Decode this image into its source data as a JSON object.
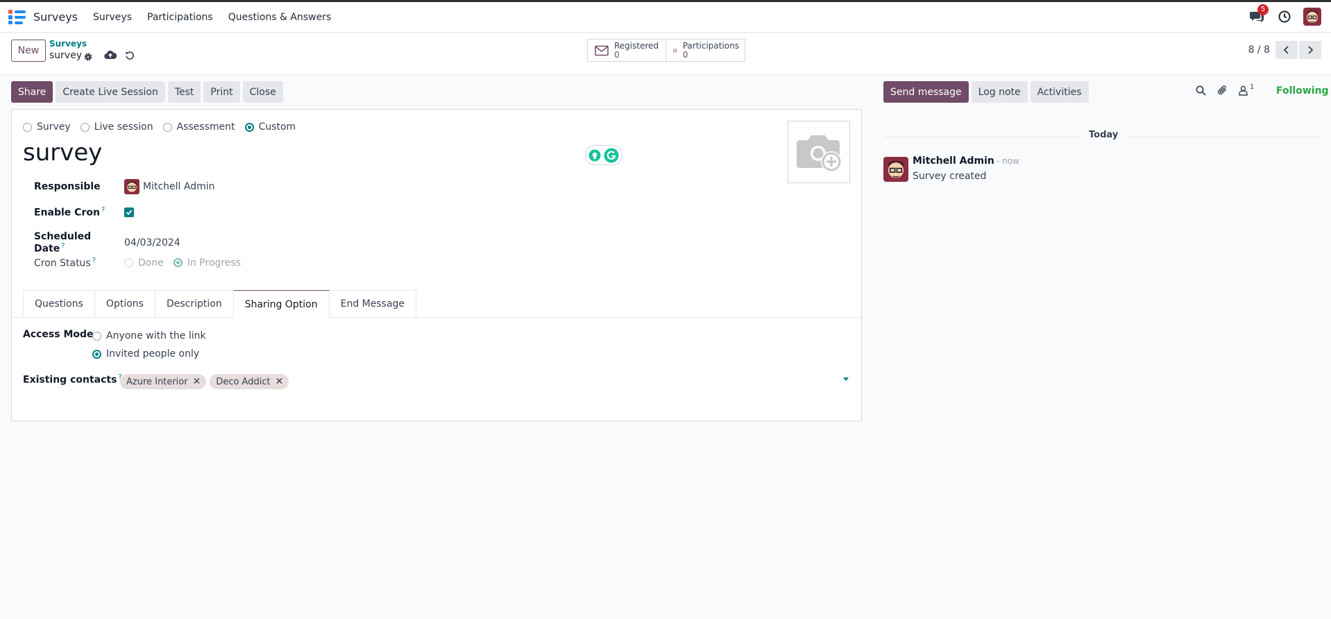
{
  "app": {
    "name": "Surveys"
  },
  "nav": {
    "menus": [
      "Surveys",
      "Participations",
      "Questions & Answers"
    ],
    "chat_badge": "5"
  },
  "control_panel": {
    "new_label": "New",
    "breadcrumb_parent": "Surveys",
    "breadcrumb_current": "survey",
    "stats": [
      {
        "label": "Registered",
        "value": "0",
        "icon": "envelope-icon"
      },
      {
        "label": "Participations",
        "value": "0",
        "icon": "check-square-icon"
      }
    ],
    "pager": "8 / 8"
  },
  "toolbar": {
    "share": "Share",
    "live_session": "Create Live Session",
    "test": "Test",
    "print": "Print",
    "close": "Close"
  },
  "form": {
    "survey_types": [
      "Survey",
      "Live session",
      "Assessment",
      "Custom"
    ],
    "selected_type": "Custom",
    "title": "survey",
    "responsible_label": "Responsible",
    "responsible_value": "Mitchell Admin",
    "enable_cron_label": "Enable Cron",
    "enable_cron_help": "?",
    "enable_cron_checked": true,
    "scheduled_date_label": "Scheduled Date",
    "scheduled_date_help": "?",
    "scheduled_date_value": "04/03/2024",
    "cron_status_label": "Cron Status",
    "cron_status_help": "?",
    "cron_status_options": [
      "Done",
      "In Progress"
    ],
    "cron_status_selected": "In Progress",
    "tabs": [
      "Questions",
      "Options",
      "Description",
      "Sharing Option",
      "End Message"
    ],
    "active_tab": "Sharing Option",
    "access_mode_label": "Access Mode",
    "access_mode_options": [
      "Anyone with the link",
      "Invited people only"
    ],
    "access_mode_selected": "Invited people only",
    "existing_contacts_label": "Existing contacts",
    "existing_contacts_help": "?",
    "contacts": [
      "Azure Interior",
      "Deco Addict"
    ]
  },
  "chatter": {
    "send_message": "Send message",
    "log_note": "Log note",
    "activities": "Activities",
    "followers_count": "1",
    "following": "Following",
    "today": "Today",
    "message": {
      "author": "Mitchell Admin",
      "time": "- now",
      "body": "Survey created"
    }
  },
  "colors": {
    "brand": "#714b67",
    "accent": "#017e84",
    "following": "#28a745",
    "badge": "#d0262e"
  }
}
